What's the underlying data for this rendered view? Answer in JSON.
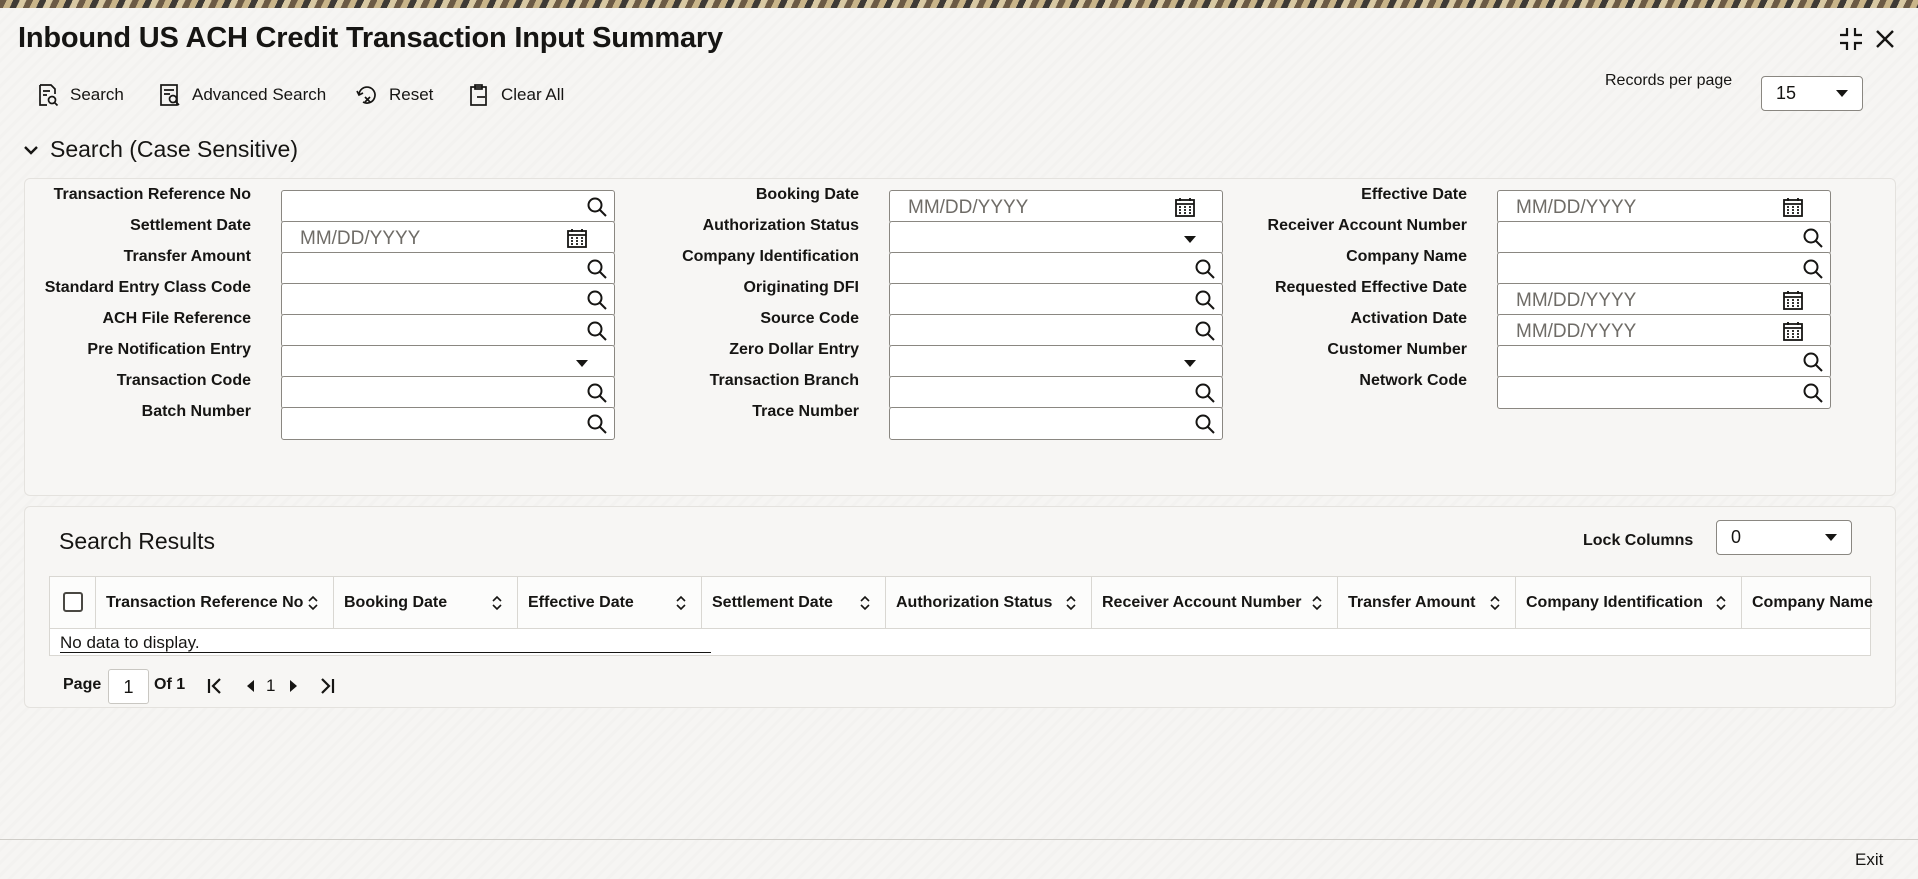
{
  "window": {
    "title": "Inbound US ACH Credit Transaction Input Summary"
  },
  "toolbar": {
    "search": "Search",
    "advanced_search": "Advanced Search",
    "reset": "Reset",
    "clear_all": "Clear All",
    "records_per_page_label": "Records per page",
    "records_per_page_value": "15"
  },
  "search_section": {
    "title": "Search (Case Sensitive)",
    "date_placeholder": "MM/DD/YYYY",
    "col1": [
      "Transaction Reference No",
      "Settlement Date",
      "Transfer Amount",
      "Standard Entry Class Code",
      "ACH File Reference",
      "Pre Notification Entry",
      "Transaction Code",
      "Batch Number"
    ],
    "col2": [
      "Booking Date",
      "Authorization Status",
      "Company Identification",
      "Originating DFI",
      "Source Code",
      "Zero Dollar Entry",
      "Transaction Branch",
      "Trace Number"
    ],
    "col3": [
      "Effective Date",
      "Receiver Account Number",
      "Company Name",
      "Requested Effective Date",
      "Activation Date",
      "Customer Number",
      "Network Code"
    ]
  },
  "results": {
    "title": "Search Results",
    "lock_columns_label": "Lock Columns",
    "lock_columns_value": "0",
    "columns": [
      "Transaction Reference No",
      "Booking Date",
      "Effective Date",
      "Settlement Date",
      "Authorization Status",
      "Receiver Account Number",
      "Transfer Amount",
      "Company Identification",
      "Company Name"
    ],
    "empty_text": "No data to display.",
    "pager": {
      "page_label": "Page",
      "page_value": "1",
      "of_label": "Of 1",
      "current": "1"
    }
  },
  "footer": {
    "exit": "Exit"
  }
}
